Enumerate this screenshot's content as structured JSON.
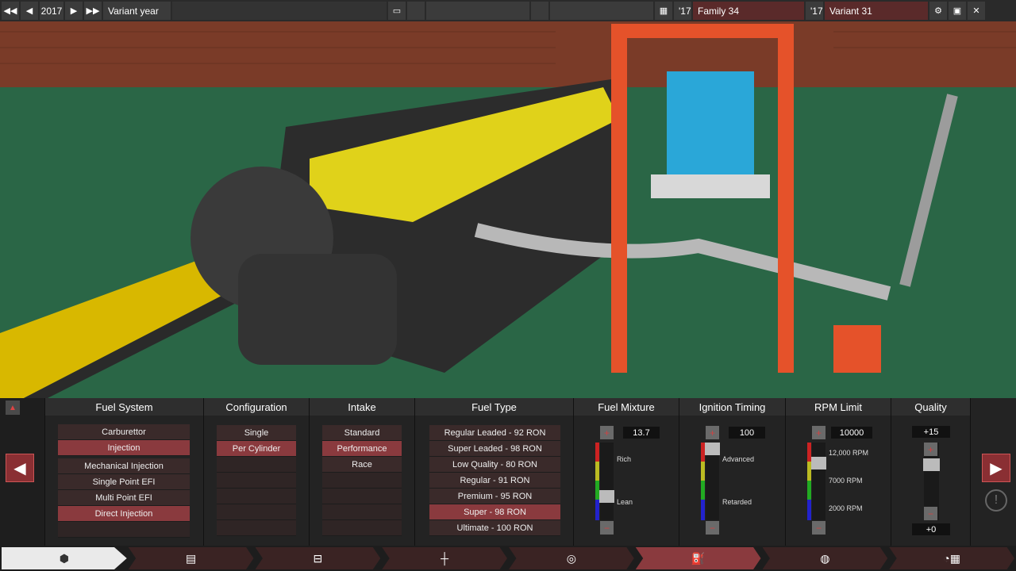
{
  "topbar": {
    "year": "2017",
    "variant_year_label": "Variant year",
    "family_year": "'17",
    "family_name": "Family 34",
    "variant_year": "'17",
    "variant_name": "Variant 31"
  },
  "columns": {
    "fuel_system": {
      "title": "Fuel System",
      "group1": [
        "Carburettor",
        "Injection"
      ],
      "group2": [
        "Mechanical Injection",
        "Single Point EFI",
        "Multi Point EFI",
        "Direct Injection"
      ]
    },
    "configuration": {
      "title": "Configuration",
      "options": [
        "Single",
        "Per Cylinder"
      ]
    },
    "intake": {
      "title": "Intake",
      "options": [
        "Standard",
        "Performance",
        "Race"
      ]
    },
    "fuel_type": {
      "title": "Fuel Type",
      "options": [
        "Regular Leaded - 92 RON",
        "Super Leaded - 98 RON",
        "Low Quality - 80 RON",
        "Regular - 91 RON",
        "Premium - 95 RON",
        "Super - 98 RON",
        "Ultimate - 100 RON"
      ]
    },
    "fuel_mixture": {
      "title": "Fuel Mixture",
      "value": "13.7",
      "high_label": "Rich",
      "low_label": "Lean"
    },
    "ignition_timing": {
      "title": "Ignition Timing",
      "value": "100",
      "high_label": "Advanced",
      "low_label": "Retarded"
    },
    "rpm_limit": {
      "title": "RPM Limit",
      "value": "10000",
      "tick_high": "12,000 RPM",
      "tick_mid": "7000 RPM",
      "tick_low": "2000 RPM"
    },
    "quality": {
      "title": "Quality",
      "max": "+15",
      "min": "+0"
    }
  },
  "icons": {
    "prev": "left-arrow",
    "next": "right-arrow",
    "info": "info-icon"
  },
  "colors": {
    "accent": "#8a3a3e",
    "panel": "#232323"
  }
}
